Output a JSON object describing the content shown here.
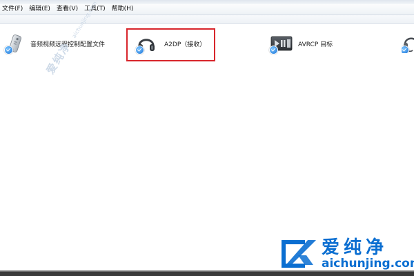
{
  "menubar": {
    "items": [
      {
        "label": "文件(F)"
      },
      {
        "label": "编辑(E)"
      },
      {
        "label": "查看(V)"
      },
      {
        "label": "工具(T)"
      },
      {
        "label": "帮助(H)"
      }
    ]
  },
  "devices": [
    {
      "label": "音频视频远程控制配置文件",
      "icon": "remote-control-icon"
    },
    {
      "label": "A2DP（接收）",
      "icon": "headphones-icon",
      "highlighted": true
    },
    {
      "label": "AVRCP 目标",
      "icon": "media-player-icon"
    },
    {
      "label": "",
      "icon": "headset-icon"
    }
  ],
  "watermark": {
    "diagonal_text": "爱纯净",
    "diagonal_url": "aichunjing.com",
    "corner_text": "爱纯净",
    "corner_url": "aichunjing.com",
    "color": "#0a6ed1"
  },
  "colors": {
    "highlight": "#d8252b",
    "check_badge": "#1a74d8"
  }
}
